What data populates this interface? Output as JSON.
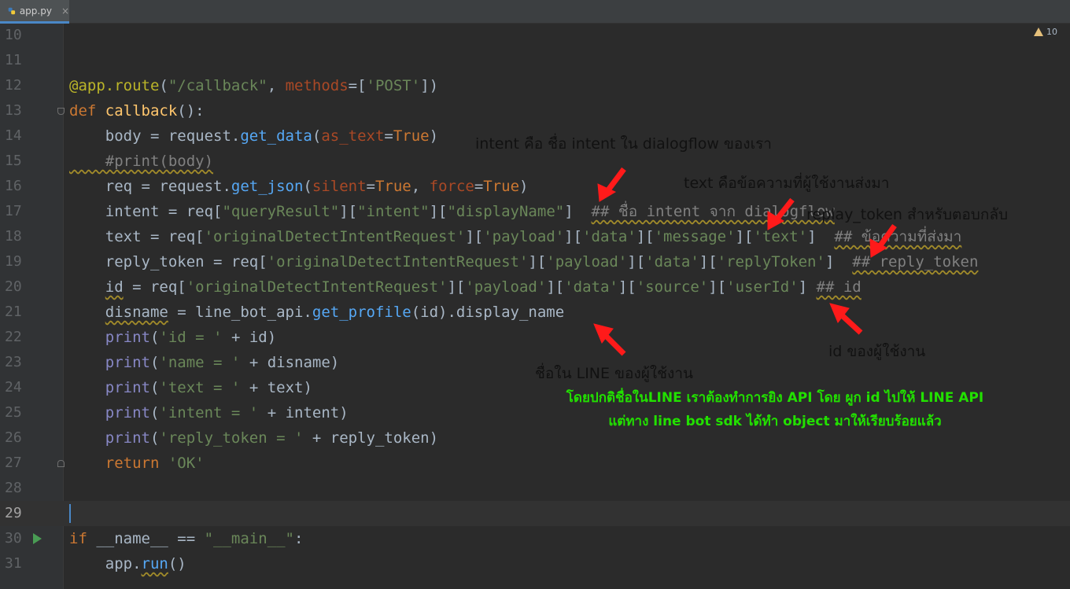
{
  "tab": {
    "label": "app.py",
    "close": "×"
  },
  "warnings": {
    "count": "10"
  },
  "active_line": "29",
  "lines": [
    {
      "n": "10"
    },
    {
      "n": "11"
    },
    {
      "n": "12"
    },
    {
      "n": "13"
    },
    {
      "n": "14"
    },
    {
      "n": "15"
    },
    {
      "n": "16"
    },
    {
      "n": "17"
    },
    {
      "n": "18"
    },
    {
      "n": "19"
    },
    {
      "n": "20"
    },
    {
      "n": "21"
    },
    {
      "n": "22"
    },
    {
      "n": "23"
    },
    {
      "n": "24"
    },
    {
      "n": "25"
    },
    {
      "n": "26"
    },
    {
      "n": "27"
    },
    {
      "n": "28"
    },
    {
      "n": "29"
    },
    {
      "n": "30"
    },
    {
      "n": "31"
    }
  ],
  "code": {
    "l12": {
      "dec": "@app.route",
      "p1": "(",
      "s1": "\"/callback\"",
      "p2": ", ",
      "kw": "methods",
      "p3": "=[",
      "s2": "'POST'",
      "p4": "])"
    },
    "l13": {
      "def": "def",
      "name": "callback",
      "rest": "():"
    },
    "l14": {
      "a": "    body = request.",
      "fn": "get_data",
      "b": "(",
      "kw": "as_text",
      "c": "=",
      "t": "True",
      "d": ")"
    },
    "l15": {
      "cmt": "    #print(body)"
    },
    "l16": {
      "a": "    req = request.",
      "fn": "get_json",
      "b": "(",
      "kw1": "silent",
      "c": "=",
      "t1": "True",
      "d": ", ",
      "kw2": "force",
      "e": "=",
      "t2": "True",
      "f": ")"
    },
    "l17": {
      "a": "    intent = req[",
      "s1": "\"queryResult\"",
      "b": "][",
      "s2": "\"intent\"",
      "c": "][",
      "s3": "\"displayName\"",
      "d": "]  ",
      "cmt": "## ชื่อ intent จาก dialogflow"
    },
    "l18": {
      "a": "    text = req[",
      "s1": "'originalDetectIntentRequest'",
      "b": "][",
      "s2": "'payload'",
      "c": "][",
      "s3": "'data'",
      "d": "][",
      "s4": "'message'",
      "e": "][",
      "s5": "'text'",
      "f": "]  ",
      "cmt": "## ข้อความที่ส่งมา"
    },
    "l19": {
      "a": "    reply_token = req[",
      "s1": "'originalDetectIntentRequest'",
      "b": "][",
      "s2": "'payload'",
      "c": "][",
      "s3": "'data'",
      "d": "][",
      "s4": "'replyToken'",
      "e": "]  ",
      "cmt": "## reply_token"
    },
    "l20": {
      "ind": "    ",
      "id": "id",
      "a": " = req[",
      "s1": "'originalDetectIntentRequest'",
      "b": "][",
      "s2": "'payload'",
      "c": "][",
      "s3": "'data'",
      "d": "][",
      "s4": "'source'",
      "e": "][",
      "s5": "'userId'",
      "f": "] ",
      "cmt": "## id"
    },
    "l21": {
      "ind": "    ",
      "v": "disname",
      "a": " = line_bot_api.",
      "fn": "get_profile",
      "b": "(id).display_name"
    },
    "l22": {
      "ind": "    ",
      "bi": "print",
      "a": "(",
      "s": "'id = '",
      "b": " + id)"
    },
    "l23": {
      "ind": "    ",
      "bi": "print",
      "a": "(",
      "s": "'name = '",
      "b": " + disname)"
    },
    "l24": {
      "ind": "    ",
      "bi": "print",
      "a": "(",
      "s": "'text = '",
      "b": " + text)"
    },
    "l25": {
      "ind": "    ",
      "bi": "print",
      "a": "(",
      "s": "'intent = '",
      "b": " + intent)"
    },
    "l26": {
      "ind": "    ",
      "bi": "print",
      "a": "(",
      "s": "'reply_token = '",
      "b": " + reply_token)"
    },
    "l27": {
      "ind": "    ",
      "kw": "return",
      "sp": " ",
      "s": "'OK'"
    },
    "l30": {
      "kw": "if",
      "a": " __name__ == ",
      "s": "\"__main__\"",
      "b": ":"
    },
    "l31": {
      "a": "    app.",
      "fn": "run",
      "b": "()"
    }
  },
  "annotations": {
    "intent": "intent คือ ชื่อ intent ใน dialogflow ของเรา",
    "text": "text คือข้อความที่ผู้ใช้งานส่งมา",
    "reply": "replay_token สำหรับตอบกลับ",
    "id": "id ของผู้ใช้งาน",
    "name": "ชื่อใน LINE ของผู้ใช้งาน",
    "green1": "โดยปกติชื่อในLINE เราต้องทำการยิง API โดย ผูก id ไปให้ LINE API",
    "green2": "แต่ทาง line bot sdk ได้ทำ object มาให้เรียบร้อยแล้ว"
  },
  "colors": {
    "background": "#2b2b2b",
    "arrow": "#ff1a1a",
    "note_green": "#22e000"
  }
}
